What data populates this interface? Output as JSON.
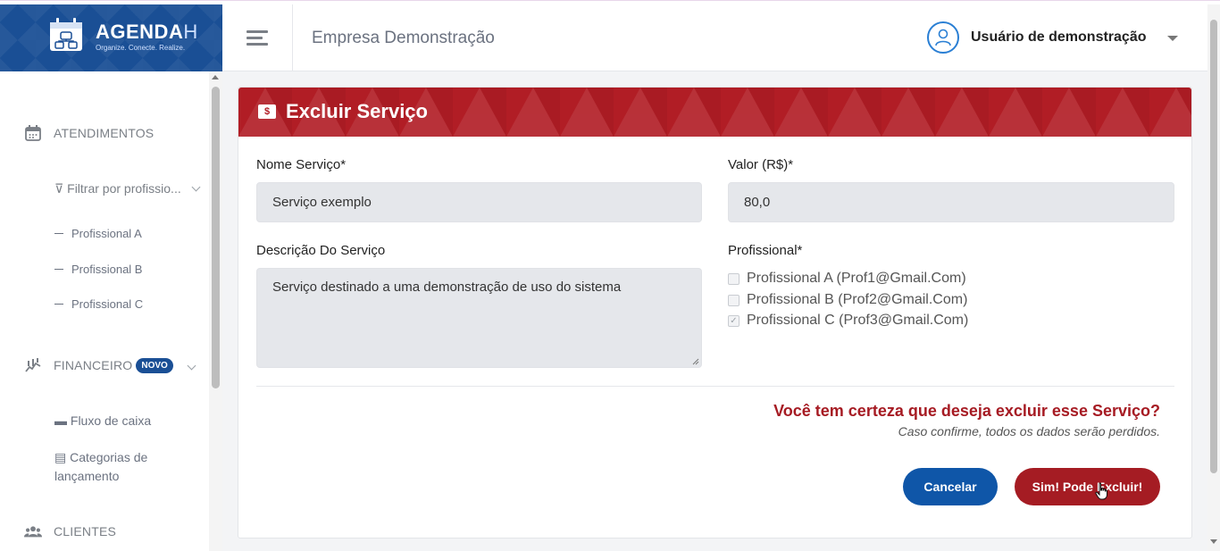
{
  "brand": {
    "name": "AGENDA",
    "name_suffix": "H",
    "tagline": "Organize. Conecte. Realize."
  },
  "header": {
    "company": "Empresa Demonstração",
    "user_name": "Usuário de demonstração"
  },
  "sidebar": {
    "atendimentos_label": "ATENDIMENTOS",
    "filter_label": "Filtrar por profissio...",
    "professionals": [
      "Profissional A",
      "Profissional B",
      "Profissional C"
    ],
    "financeiro_label": "FINANCEIRO",
    "financeiro_badge": "NOVO",
    "fluxo_label": "Fluxo de caixa",
    "categorias_label_1": "Categorias de",
    "categorias_label_2": "lançamento",
    "clientes_label": "CLIENTES"
  },
  "card": {
    "title": "Excluir Serviço",
    "name_label": "Nome Serviço*",
    "name_value": "Serviço exemplo",
    "price_label": "Valor (R$)*",
    "price_value": "80,0",
    "description_label": "Descrição Do Serviço",
    "description_value": "Serviço destinado a uma demonstração de uso do sistema",
    "professional_label": "Profissional*",
    "professional_options": [
      {
        "label": "Profissional A (Prof1@Gmail.Com)",
        "checked": false
      },
      {
        "label": "Profissional B (Prof2@Gmail.Com)",
        "checked": false
      },
      {
        "label": "Profissional C (Prof3@Gmail.Com)",
        "checked": true
      }
    ],
    "confirm_question": "Você tem certeza que deseja excluir esse Serviço?",
    "confirm_note": "Caso confirme, todos os dados serão perdidos.",
    "cancel_label": "Cancelar",
    "delete_label": "Sim! Pode Excluir!"
  },
  "colors": {
    "brand_blue": "#1a4f95",
    "danger_red": "#b11d25",
    "primary_button": "#0f56a8"
  }
}
